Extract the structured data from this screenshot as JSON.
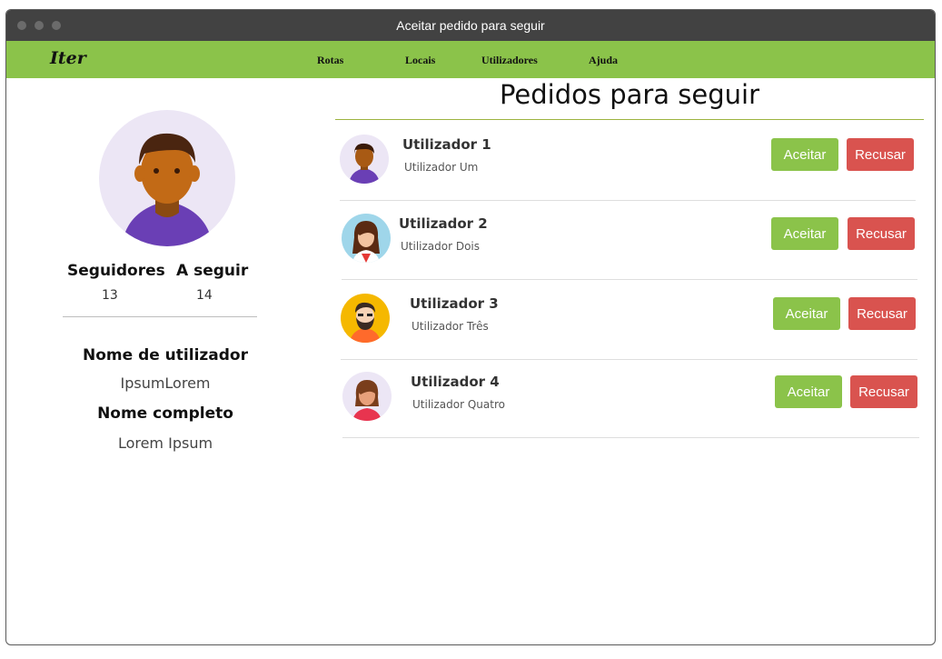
{
  "window": {
    "title": "Aceitar pedido para seguir"
  },
  "navbar": {
    "logo": "Iter",
    "items": [
      {
        "label": "Rotas"
      },
      {
        "label": "Locais"
      },
      {
        "label": "Utilizadores"
      },
      {
        "label": "Ajuda"
      }
    ]
  },
  "profile": {
    "followers_label": "Seguidores",
    "followers_count": "13",
    "following_label": "A seguir",
    "following_count": "14",
    "username_label": "Nome de utilizador",
    "username": "IpsumLorem",
    "fullname_label": "Nome completo",
    "fullname": "Lorem Ipsum"
  },
  "main": {
    "title": "Pedidos para seguir",
    "accept_label": "Aceitar",
    "reject_label": "Recusar",
    "requests": [
      {
        "username": "Utilizador 1",
        "fullname": "Utilizador Um"
      },
      {
        "username": "Utilizador 2",
        "fullname": "Utilizador Dois"
      },
      {
        "username": "Utilizador 3",
        "fullname": "Utilizador Três"
      },
      {
        "username": "Utilizador 4",
        "fullname": "Utilizador Quatro"
      }
    ]
  },
  "colors": {
    "accent": "#8bc34a",
    "danger": "#d9534f",
    "titlebar": "#424242"
  }
}
